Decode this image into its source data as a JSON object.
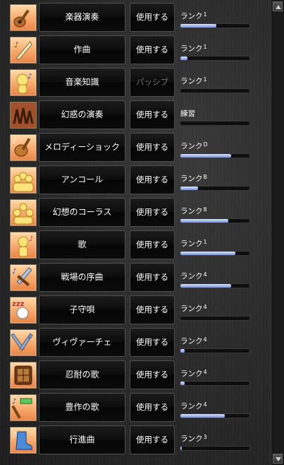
{
  "rank_prefix": "ランク",
  "skills": [
    {
      "name": "楽器演奏",
      "action": "使用する",
      "action_enabled": true,
      "rank_label": "ランク",
      "rank_level": "1",
      "progress": 0.52,
      "icon": "lute-instrument-icon"
    },
    {
      "name": "作曲",
      "action": "使用する",
      "action_enabled": true,
      "rank_label": "ランク",
      "rank_level": "1",
      "progress": 0.1,
      "icon": "quill-composition-icon"
    },
    {
      "name": "音楽知識",
      "action": "パッシブ",
      "action_enabled": false,
      "rank_label": "ランク",
      "rank_level": "1",
      "progress": 0.0,
      "icon": "music-knowledge-head-icon"
    },
    {
      "name": "幻惑の演奏",
      "action": "使用する",
      "action_enabled": true,
      "rank_label": "練習",
      "rank_level": "",
      "progress": 0.0,
      "icon": "dancing-figures-icon"
    },
    {
      "name": "メロディーショック",
      "action": "使用する",
      "action_enabled": true,
      "rank_label": "ランク",
      "rank_level": "D",
      "progress": 0.73,
      "icon": "melody-shock-lute-icon"
    },
    {
      "name": "アンコール",
      "action": "使用する",
      "action_enabled": true,
      "rank_label": "ランク",
      "rank_level": "B",
      "progress": 0.26,
      "icon": "encore-crowd-icon"
    },
    {
      "name": "幻想のコーラス",
      "action": "使用する",
      "action_enabled": true,
      "rank_label": "ランク",
      "rank_level": "8",
      "progress": 0.69,
      "icon": "chorus-group-icon"
    },
    {
      "name": "歌",
      "action": "使用する",
      "action_enabled": true,
      "rank_label": "ランク",
      "rank_level": "1",
      "progress": 0.8,
      "icon": "singing-figure-icon"
    },
    {
      "name": "戦場の序曲",
      "action": "使用する",
      "action_enabled": true,
      "rank_label": "ランク",
      "rank_level": "4",
      "progress": 0.73,
      "icon": "battlefield-sword-icon"
    },
    {
      "name": "子守唄",
      "action": "使用する",
      "action_enabled": true,
      "rank_label": "ランク",
      "rank_level": "4",
      "progress": 0.0,
      "icon": "lullaby-sleep-icon"
    },
    {
      "name": "ヴィヴァーチェ",
      "action": "使用する",
      "action_enabled": true,
      "rank_label": "ランク",
      "rank_level": "4",
      "progress": 0.06,
      "icon": "vivace-tools-icon"
    },
    {
      "name": "忍耐の歌",
      "action": "使用する",
      "action_enabled": true,
      "rank_label": "ランク",
      "rank_level": "4",
      "progress": 0.06,
      "icon": "endurance-shield-icon"
    },
    {
      "name": "豊作の歌",
      "action": "使用する",
      "action_enabled": true,
      "rank_label": "ランク",
      "rank_level": "4",
      "progress": 0.64,
      "icon": "harvest-hoe-icon"
    },
    {
      "name": "行進曲",
      "action": "使用する",
      "action_enabled": true,
      "rank_label": "ランク",
      "rank_level": "3",
      "progress": 0.02,
      "icon": "march-boot-icon"
    }
  ],
  "colors": {
    "icon_bg_top": "#ffd9a8",
    "icon_bg_bottom": "#e88348",
    "progress": "#9cb2ea",
    "passive_text": "#777777"
  }
}
